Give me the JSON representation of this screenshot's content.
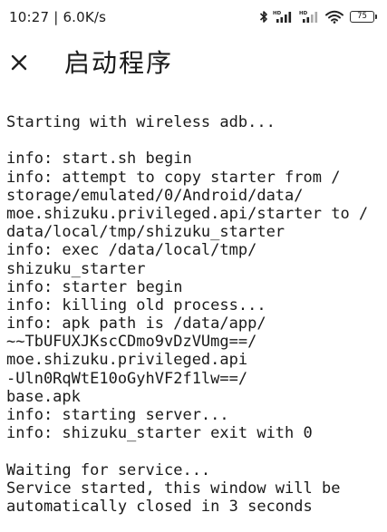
{
  "status_bar": {
    "time": "10:27",
    "network_speed": "6.0K/s",
    "separator": "|",
    "battery_level": "75",
    "icons": [
      "bluetooth-icon",
      "cellular-signal-hd-icon",
      "cellular-signal-hd-icon",
      "wifi-icon",
      "battery-icon"
    ]
  },
  "app_bar": {
    "close_icon": "close-icon",
    "title": "启动程序"
  },
  "log": {
    "lines": [
      "Starting with wireless adb...",
      "",
      "info: start.sh begin",
      "info: attempt to copy starter from /",
      "storage/emulated/0/Android/data/",
      "moe.shizuku.privileged.api/starter to /",
      "data/local/tmp/shizuku_starter",
      "info: exec /data/local/tmp/",
      "shizuku_starter",
      "info: starter begin",
      "info: killing old process...",
      "info: apk path is /data/app/",
      "~~TbUFUXJKscCDmo9vDzVUmg==/",
      "moe.shizuku.privileged.api",
      "-Uln0RqWtE10oGyhVF2f1lw==/",
      "base.apk",
      "info: starting server...",
      "info: shizuku_starter exit with 0",
      "",
      "Waiting for service...",
      "Service started, this window will be",
      "automatically closed in 3 seconds"
    ]
  }
}
